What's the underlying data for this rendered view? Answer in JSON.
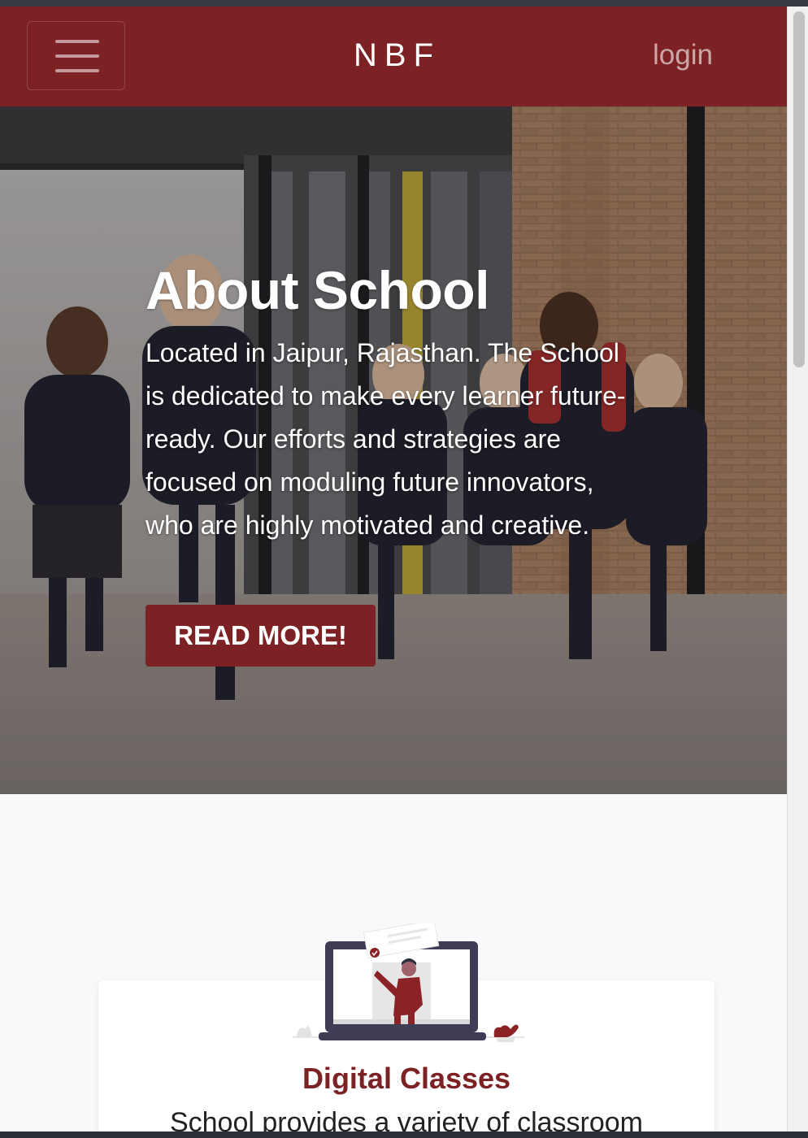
{
  "navbar": {
    "brand": "NBF",
    "login_label": "login",
    "menu_icon": "hamburger-menu-icon"
  },
  "hero": {
    "title": "About School",
    "text": "Located in Jaipur, Rajasthan. The School is dedicated to make every learner future-ready. Our efforts and strategies are focused on moduling future innovators, who are highly motivated and creative.",
    "button_label": "READ MORE!"
  },
  "features": [
    {
      "title": "Digital Classes",
      "text": "School provides a variety of classroom",
      "icon": "teacher-laptop-illustration"
    }
  ],
  "colors": {
    "brand": "#7c2124",
    "background": "#f8f9fa"
  }
}
